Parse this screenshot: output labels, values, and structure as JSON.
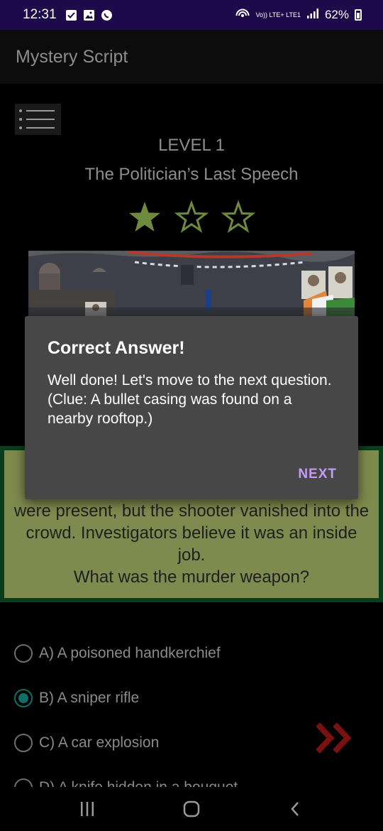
{
  "status_bar": {
    "time": "12:31",
    "network_label": "Vo)) LTE+ LTE1",
    "battery": "62%"
  },
  "app_bar": {
    "title": "Mystery Script"
  },
  "level": {
    "label": "LEVEL 1",
    "title": "The Politician’s Last Speech",
    "stars_filled": 1,
    "stars_total": 3
  },
  "question": {
    "text": "were present, but the shooter vanished into the crowd. Investigators believe it was an inside job.",
    "prompt": "What was the murder weapon?"
  },
  "options": [
    {
      "label": "A) A poisoned handkerchief",
      "selected": false
    },
    {
      "label": "B) A sniper rifle",
      "selected": true
    },
    {
      "label": "C) A car explosion",
      "selected": false
    },
    {
      "label": "D) A knife hidden in a bouquet",
      "selected": false
    }
  ],
  "dialog": {
    "title": "Correct Answer!",
    "message": "Well done! Let's move to the next question.\n(Clue: A bullet casing was found on a nearby rooftop.)",
    "button": "NEXT"
  },
  "colors": {
    "status_bar_bg": "#1c0a4a",
    "star": "#6e8a3d",
    "question_bg": "#7f8a4e",
    "question_border": "#0a3d1c",
    "radio_selected": "#0f6e66",
    "next_arrow": "#7a1010",
    "dialog_bg": "#474747",
    "dialog_button": "#c39cf7"
  }
}
